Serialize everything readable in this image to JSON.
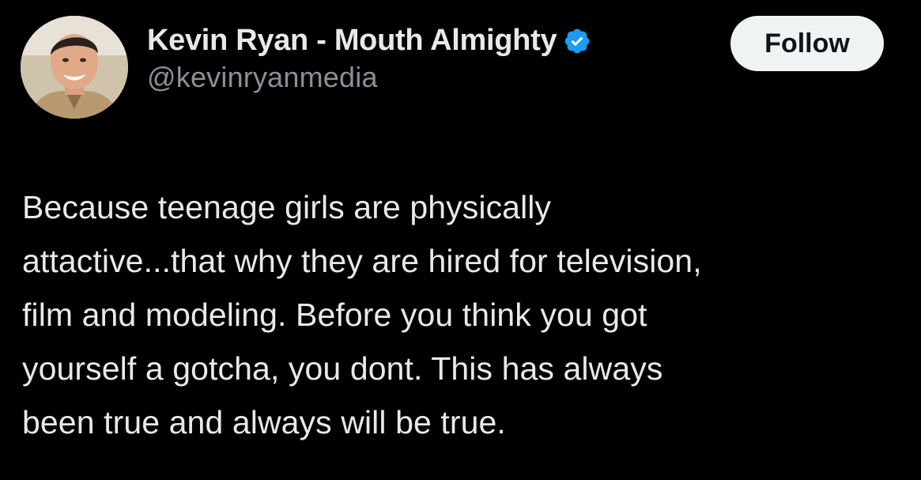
{
  "tweet": {
    "author": {
      "display_name": "Kevin Ryan - Mouth Almighty",
      "handle": "@kevinryanmedia",
      "verified": true,
      "avatar_icon": "profile-photo"
    },
    "follow_label": "Follow",
    "text": "Because teenage girls are physically\nattactive...that why they are hired for television,\nfilm and modeling.  Before you think you got\nyourself a gotcha, you dont.  This has always\nbeen true and always will be true."
  },
  "colors": {
    "background": "#000000",
    "primary_text": "#e7e9ea",
    "secondary_text": "#8b9096",
    "verified_blue": "#1d9bf0",
    "follow_button_bg": "#eff3f4",
    "follow_button_text": "#0f1419"
  }
}
